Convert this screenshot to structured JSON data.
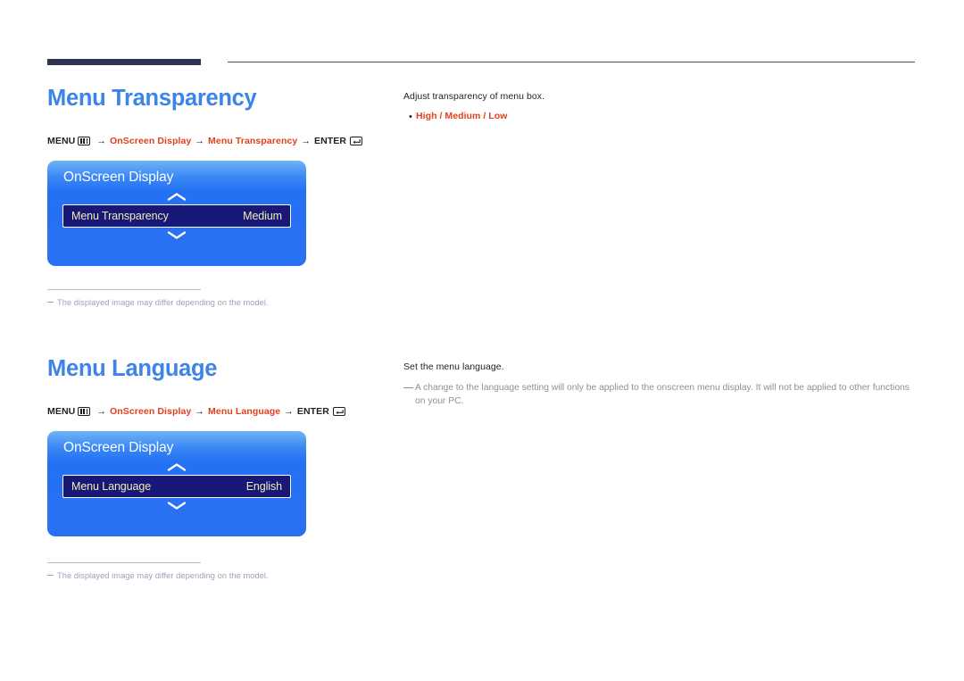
{
  "header": {
    "rule_thick_color": "#2e3354",
    "rule_thin_color": "#4b4f6b"
  },
  "theme": {
    "title_blue": "#3d84e8",
    "accent_red": "#e2401c",
    "osd_blue": "#2a70f2",
    "osd_row_navy": "#181878",
    "osd_row_text": "#f3ecb2",
    "note_gray": "#8e9099",
    "footnote_gray": "#9ea1b8"
  },
  "sections": [
    {
      "id": "transparency",
      "title": "Menu Transparency",
      "breadcrumb": {
        "menu_label": "MENU",
        "menu_icon": "menu-grid-icon",
        "arrow": "→",
        "path": [
          "OnScreen Display",
          "Menu Transparency"
        ],
        "enter_label": "ENTER",
        "enter_icon": "enter-return-icon"
      },
      "osd": {
        "title": "OnScreen Display",
        "chevron_up": "chevron-up-icon",
        "chevron_down": "chevron-down-icon",
        "row_label": "Menu Transparency",
        "row_value": "Medium"
      },
      "footnote": "The displayed image may differ depending on the model.",
      "right": {
        "lead": "Adjust transparency of menu box.",
        "bullet_dot": "•",
        "bullet_text": "High / Medium / Low",
        "note": ""
      }
    },
    {
      "id": "language",
      "title": "Menu Language",
      "breadcrumb": {
        "menu_label": "MENU",
        "menu_icon": "menu-grid-icon",
        "arrow": "→",
        "path": [
          "OnScreen Display",
          "Menu Language"
        ],
        "enter_label": "ENTER",
        "enter_icon": "enter-return-icon"
      },
      "osd": {
        "title": "OnScreen Display",
        "chevron_up": "chevron-up-icon",
        "chevron_down": "chevron-down-icon",
        "row_label": "Menu Language",
        "row_value": "English"
      },
      "footnote": "The displayed image may differ depending on the model.",
      "right": {
        "lead": "Set the menu language.",
        "bullet_dot": "",
        "bullet_text": "",
        "note": "A change to the language setting will only be applied to the onscreen menu display. It will not be applied to other functions on your PC."
      }
    }
  ]
}
